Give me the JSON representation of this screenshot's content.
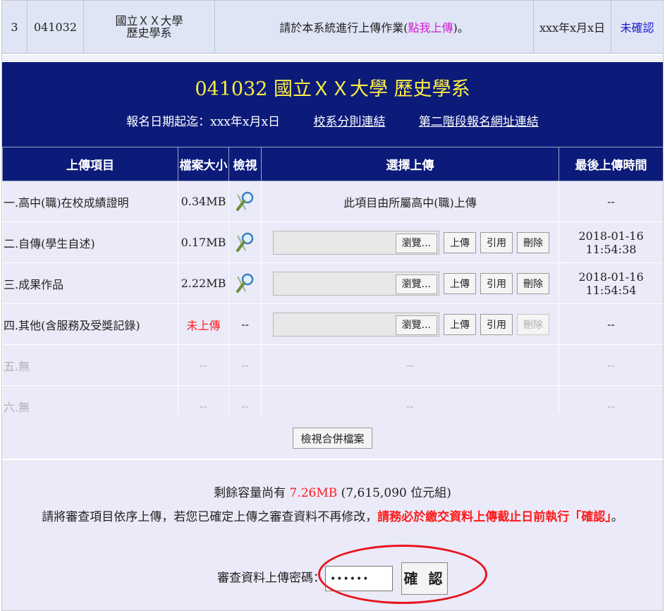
{
  "top_row": {
    "index": "3",
    "code": "041032",
    "school_line1": "國立ＸＸ大學",
    "school_line2": "歷史學系",
    "instruction_pre": "請於本系統進行上傳作業(",
    "instruction_link": "點我上傳",
    "instruction_post": ")。",
    "date": "xxx年x月x日",
    "status": "未確認"
  },
  "header": {
    "title": "041032 國立ＸＸ大學 歷史學系",
    "deadline": "報名日期起迄：xxx年x月x日",
    "link1": "校系分則連結",
    "link2": "第二階段報名網址連結"
  },
  "table": {
    "headers": [
      "上傳項目",
      "檔案大小",
      "檢視",
      "選擇上傳",
      "最後上傳時間"
    ],
    "rows": [
      {
        "item": "一.高中(職)在校成績證明",
        "size": "0.34MB",
        "note": "此項目由所屬高中(職)上傳",
        "time": "--"
      },
      {
        "item": "二.自傳(學生自述)",
        "size": "0.17MB",
        "time": "2018-01-16 11:54:38"
      },
      {
        "item": "三.成果作品",
        "size": "2.22MB",
        "time": "2018-01-16 11:54:54"
      },
      {
        "item": "四.其他(含服務及受獎記錄)",
        "size": "未上傳",
        "view": "--",
        "time": "--"
      },
      {
        "item": "五.無",
        "size": "--",
        "view": "--",
        "upload": "--",
        "time": "--"
      },
      {
        "item": "六.無",
        "size": "--",
        "view": "--",
        "upload": "--",
        "time": "--"
      }
    ],
    "buttons": {
      "browse": "瀏覽...",
      "upload": "上傳",
      "cite": "引用",
      "delete": "刪除"
    }
  },
  "merge_button": "檢視合併檔案",
  "capacity": {
    "prefix": "剩餘容量尚有 ",
    "value": "7.26MB",
    "suffix": " (7,615,090 位元組)"
  },
  "notice": {
    "text": "請將審查項目依序上傳，若您已確定上傳之審查資料不再修改，",
    "bold": "請務必於繳交資料上傳截止日前執行「確認」",
    "end": "。"
  },
  "password": {
    "label": "審查資料上傳密碼：",
    "value": "••••••",
    "confirm": "確 認"
  },
  "colors": {
    "header_bg": "#0c1b7a",
    "title": "#ffee44",
    "alert": "#ff2020",
    "row_bg": "#eaeaf8"
  }
}
